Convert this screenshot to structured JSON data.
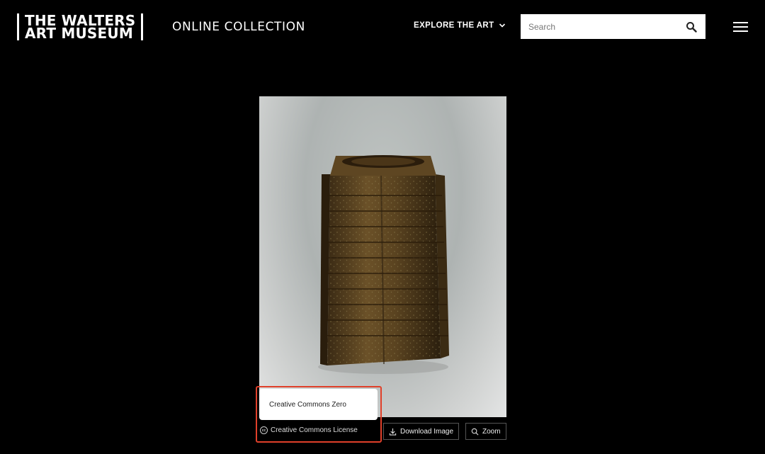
{
  "header": {
    "logo_line1": "THE WALTERS",
    "logo_line2": "ART MUSEUM",
    "section_title": "ONLINE COLLECTION",
    "explore_label": "EXPLORE THE ART",
    "search_placeholder": "Search"
  },
  "icons": {
    "search": "search-icon",
    "menu": "hamburger-menu-icon",
    "explore_toggle": "chevron-down-icon",
    "license": "creative-commons-icon",
    "download": "download-icon",
    "zoom": "magnifier-icon"
  },
  "tooltip": {
    "text": "Creative Commons Zero"
  },
  "controls": {
    "license_label": "Creative Commons License",
    "cc_badge": "cc",
    "download_label": "Download Image",
    "zoom_label": "Zoom"
  },
  "colors": {
    "background": "#000000",
    "highlight": "#e0402a",
    "text": "#ffffff"
  }
}
